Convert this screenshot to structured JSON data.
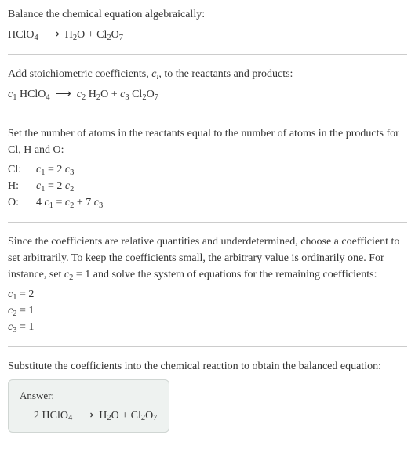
{
  "intro": {
    "title": "Balance the chemical equation algebraically:",
    "eq_lhs": "HClO",
    "eq_lhs_sub": "4",
    "arrow": "⟶",
    "eq_r1": "H",
    "eq_r1_sub": "2",
    "eq_r1b": "O + Cl",
    "eq_r1c_sub": "2",
    "eq_r1d": "O",
    "eq_r1e_sub": "7"
  },
  "step1": {
    "text_a": "Add stoichiometric coefficients, ",
    "ci": "c",
    "ci_sub": "i",
    "text_b": ", to the reactants and products:",
    "c1": "c",
    "c1_sub": "1",
    "sp1": " HClO",
    "sp1_sub": "4",
    "arrow": "⟶",
    "c2": "c",
    "c2_sub": "2",
    "sp2": " H",
    "sp2_sub": "2",
    "sp2b": "O + ",
    "c3": "c",
    "c3_sub": "3",
    "sp3": " Cl",
    "sp3_sub": "2",
    "sp3b": "O",
    "sp3c_sub": "7"
  },
  "step2": {
    "text": "Set the number of atoms in the reactants equal to the number of atoms in the products for Cl, H and O:",
    "rows": [
      {
        "label": "Cl:",
        "c_l": "c",
        "c_l_sub": "1",
        "mid": " = 2 ",
        "c_r": "c",
        "c_r_sub": "3"
      },
      {
        "label": "H:",
        "c_l": "c",
        "c_l_sub": "1",
        "mid": " = 2 ",
        "c_r": "c",
        "c_r_sub": "2"
      }
    ],
    "row_o": {
      "label": "O:",
      "p1": "4 ",
      "c1": "c",
      "c1_sub": "1",
      "mid": " = ",
      "c2": "c",
      "c2_sub": "2",
      "plus": " + 7 ",
      "c3": "c",
      "c3_sub": "3"
    }
  },
  "step3": {
    "text_a": "Since the coefficients are relative quantities and underdetermined, choose a coefficient to set arbitrarily. To keep the coefficients small, the arbitrary value is ordinarily one. For instance, set ",
    "cvar": "c",
    "cvar_sub": "2",
    "cvar_val": " = 1",
    "text_b": " and solve the system of equations for the remaining coefficients:",
    "solutions": [
      {
        "c": "c",
        "sub": "1",
        "val": " = 2"
      },
      {
        "c": "c",
        "sub": "2",
        "val": " = 1"
      },
      {
        "c": "c",
        "sub": "3",
        "val": " = 1"
      }
    ]
  },
  "step4": {
    "text": "Substitute the coefficients into the chemical reaction to obtain the balanced equation:"
  },
  "answer": {
    "label": "Answer:",
    "coef": "2 HClO",
    "coef_sub": "4",
    "arrow": "⟶",
    "r1": " H",
    "r1_sub": "2",
    "r1b": "O + Cl",
    "r1c_sub": "2",
    "r1d": "O",
    "r1e_sub": "7"
  }
}
